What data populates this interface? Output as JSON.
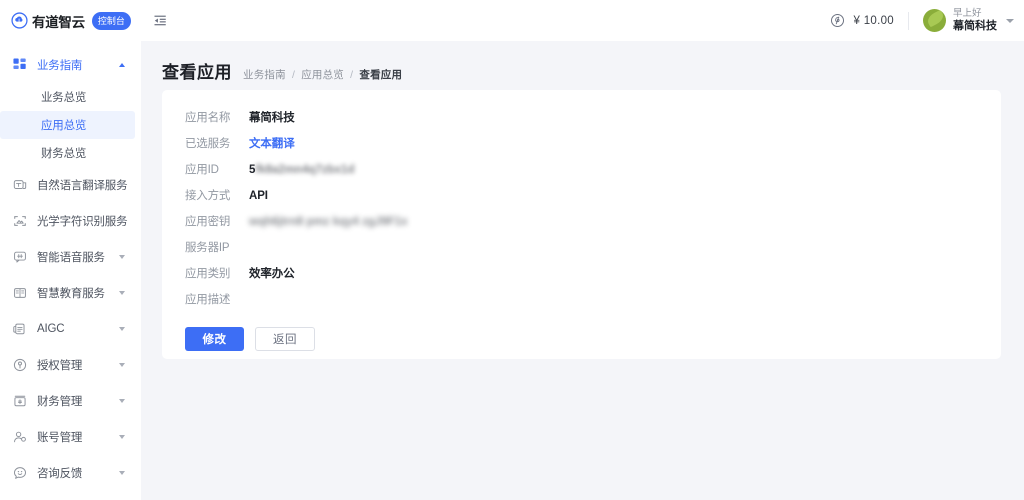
{
  "topbar": {
    "logo_icon": "cloud-icon",
    "logo_text": "有道智云",
    "console_badge": "控制台",
    "collapse_icon": "sidebar-collapse-icon",
    "balance_icon": "coin-icon",
    "balance": "¥ 10.00",
    "greeting": "早上好",
    "username": "幕简科技",
    "dropdown_icon": "chevron-down-icon"
  },
  "sidebar": {
    "groups": [
      {
        "label": "业务指南",
        "icon": "dashboard-grid-icon",
        "expanded": true,
        "arrow": "chevron-up-icon",
        "children": [
          {
            "label": "业务总览",
            "active": false
          },
          {
            "label": "应用总览",
            "active": true
          },
          {
            "label": "财务总览",
            "active": false
          }
        ]
      },
      {
        "label": "自然语言翻译服务",
        "icon": "translate-icon",
        "expanded": false,
        "arrow": "chevron-down-icon"
      },
      {
        "label": "光学字符识别服务",
        "icon": "ocr-scan-icon",
        "expanded": false,
        "arrow": "chevron-down-icon"
      },
      {
        "label": "智能语音服务",
        "icon": "speech-bubble-icon",
        "expanded": false,
        "arrow": "chevron-down-icon"
      },
      {
        "label": "智慧教育服务",
        "icon": "education-book-icon",
        "expanded": false,
        "arrow": "chevron-down-icon"
      },
      {
        "label": "AIGC",
        "icon": "aigc-document-icon",
        "expanded": false,
        "arrow": "chevron-down-icon"
      },
      {
        "label": "授权管理",
        "icon": "key-shield-icon",
        "expanded": false,
        "arrow": "chevron-down-icon"
      },
      {
        "label": "财务管理",
        "icon": "finance-box-icon",
        "expanded": false,
        "arrow": "chevron-down-icon"
      },
      {
        "label": "账号管理",
        "icon": "user-account-icon",
        "expanded": false,
        "arrow": "chevron-down-icon"
      },
      {
        "label": "咨询反馈",
        "icon": "feedback-smiley-icon",
        "expanded": false,
        "arrow": "chevron-down-icon"
      }
    ]
  },
  "page": {
    "title": "查看应用",
    "breadcrumb": {
      "items": [
        "业务指南",
        "应用总览",
        "查看应用"
      ],
      "separator": "/"
    }
  },
  "form": {
    "fields": [
      {
        "label": "应用名称",
        "value": "幕简科技",
        "type": "text"
      },
      {
        "label": "已选服务",
        "value": "文本翻译",
        "type": "link"
      },
      {
        "label": "应用ID",
        "value_visible": "5",
        "value_masked": "fk8a2mn4q7zbx1d",
        "type": "masked-id"
      },
      {
        "label": "接入方式",
        "value": "API",
        "type": "text"
      },
      {
        "label": "应用密钥",
        "value_masked": "wqh6jtrn8  pmz kqy4 zgJ9F1x",
        "type": "masked"
      },
      {
        "label": "服务器IP",
        "value": "",
        "type": "text"
      },
      {
        "label": "应用类别",
        "value": "效率办公",
        "type": "text"
      },
      {
        "label": "应用描述",
        "value": "",
        "type": "text"
      }
    ],
    "buttons": {
      "primary": "修改",
      "secondary": "返回"
    }
  },
  "colors": {
    "accent": "#3d6ef5",
    "page_bg": "#f4f5f9",
    "card_bg": "#ffffff",
    "active_nav_bg": "#eef3fe",
    "avatar": "#8aad3a"
  }
}
